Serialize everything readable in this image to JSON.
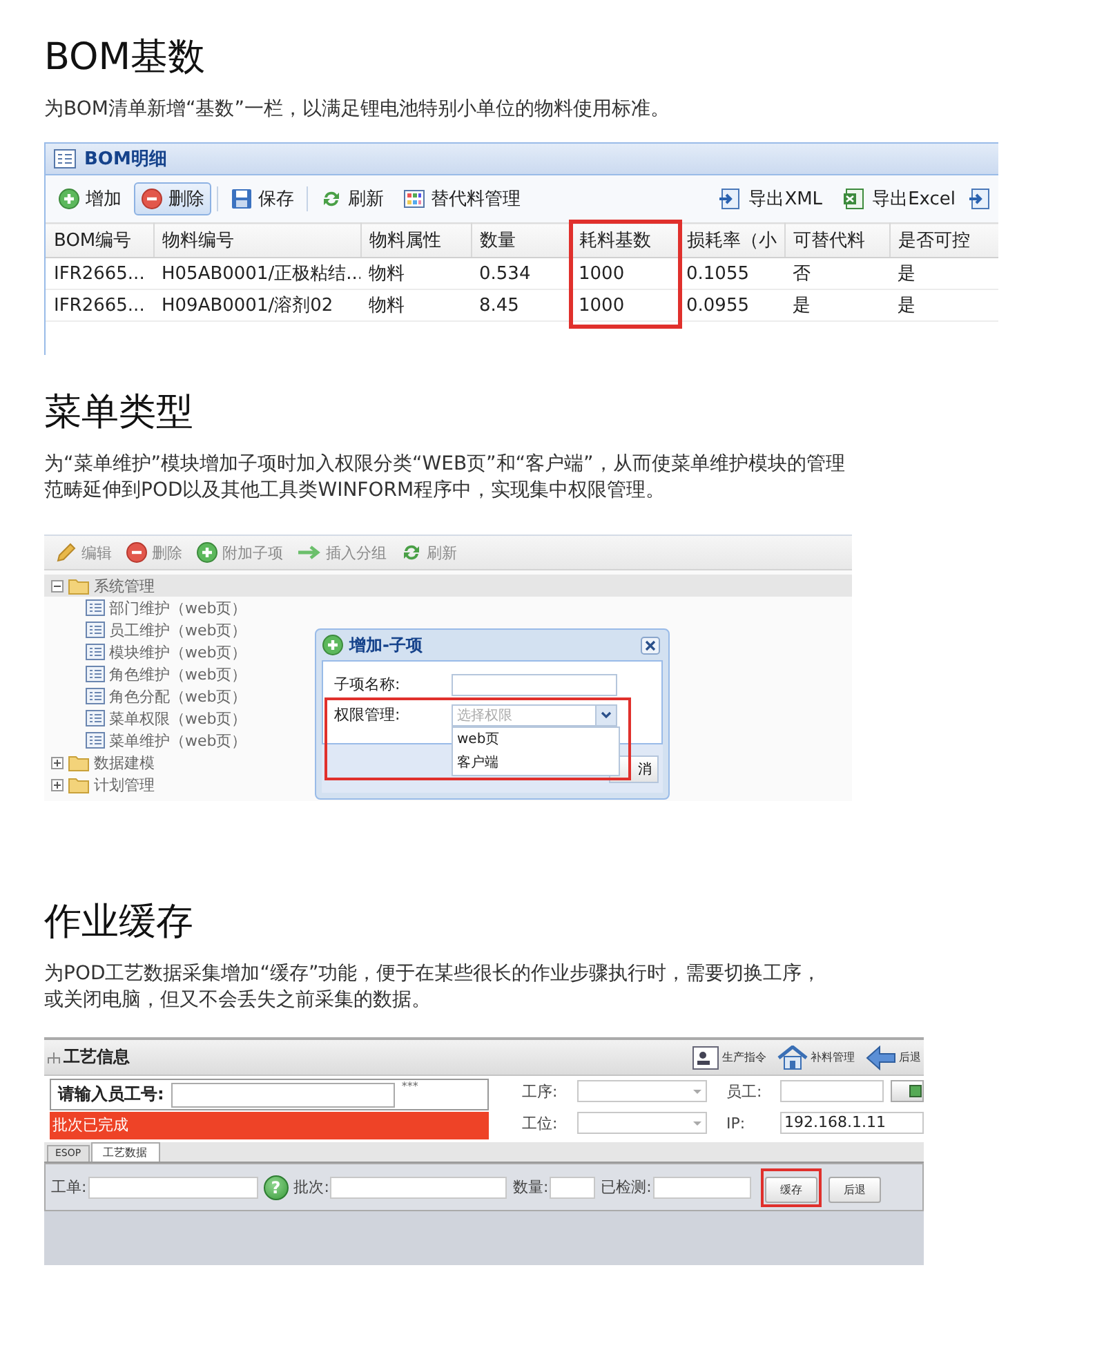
{
  "sections": [
    {
      "kind": "bom",
      "title": "BOM基数",
      "description": [
        "为BOM清单新增“基数”一栏，以满足锂电池特别小单位的物料使用标准。"
      ],
      "panel": {
        "title": "BOM明细",
        "toolbar": [
          {
            "label": "增加",
            "pressed": false
          },
          {
            "label": "删除",
            "pressed": true
          },
          {
            "label": "保存",
            "pressed": false
          },
          {
            "label": "刷新",
            "pressed": false
          },
          {
            "label": "替代料管理",
            "pressed": false
          }
        ],
        "toolbar_right": [
          {
            "label": "导出XML"
          },
          {
            "label": "导出Excel"
          }
        ],
        "columns": [
          {
            "label": "BOM编号",
            "highlighted": false
          },
          {
            "label": "物料编号",
            "highlighted": false
          },
          {
            "label": "物料属性",
            "highlighted": false
          },
          {
            "label": "数量",
            "highlighted": false
          },
          {
            "label": "耗料基数",
            "highlighted": true
          },
          {
            "label": "损耗率（小",
            "highlighted": false
          },
          {
            "label": "可替代料",
            "highlighted": false
          },
          {
            "label": "是否可控",
            "highlighted": false
          }
        ],
        "rows": [
          [
            "IFR2665...",
            "H05AB0001/正极粘结...",
            "物料",
            "0.534",
            "1000",
            "0.1055",
            "否",
            "是"
          ],
          [
            "IFR2665...",
            "H09AB0001/溶剂02",
            "物料",
            "8.45",
            "1000",
            "0.0955",
            "是",
            "是"
          ]
        ]
      }
    },
    {
      "kind": "menu",
      "title": "菜单类型",
      "description": [
        "为“菜单维护”模块增加子项时加入权限分类“WEB页”和“客户端”，从而使菜单维护模块的管理",
        "范畴延伸到POD以及其他工具类WINFORM程序中，实现集中权限管理。"
      ],
      "panel": {
        "toolbar": [
          {
            "label": "编辑"
          },
          {
            "label": "删除"
          },
          {
            "label": "附加子项"
          },
          {
            "label": "插入分组"
          },
          {
            "label": "刷新"
          }
        ],
        "tree": [
          {
            "label": "系统管理",
            "expanded": true,
            "selected": true,
            "children": [
              {
                "label": "部门维护（web页）",
                "selected": false
              },
              {
                "label": "员工维护（web页）",
                "selected": false
              },
              {
                "label": "模块维护（web页）",
                "selected": false
              },
              {
                "label": "角色维护（web页）",
                "selected": false
              },
              {
                "label": "角色分配（web页）",
                "selected": false
              },
              {
                "label": "菜单权限（web页）",
                "selected": false
              },
              {
                "label": "菜单维护（web页）",
                "selected": false
              }
            ]
          },
          {
            "label": "数据建模",
            "expanded": false,
            "selected": false
          },
          {
            "label": "计划管理",
            "expanded": false,
            "selected": false
          }
        ],
        "dialog": {
          "title": "增加-子项",
          "fields": [
            {
              "label": "子项名称:",
              "kind": "text",
              "highlighted": false
            },
            {
              "label": "权限管理:",
              "kind": "select",
              "placeholder": "选择权限",
              "options": [
                "web页",
                "客户端"
              ],
              "highlighted": true
            }
          ],
          "buttons": [
            "消"
          ]
        }
      }
    },
    {
      "kind": "process",
      "title": "作业缓存",
      "description": [
        "为POD工艺数据采集增加“缓存”功能，便于在某些很长的作业步骤执行时，需要切换工序，",
        "或关闭电脑，但又不会丢失之前采集的数据。"
      ],
      "panel": {
        "title": "工艺信息",
        "actions": [
          {
            "label": "生产指令"
          },
          {
            "label": "补料管理"
          },
          {
            "label": "后退"
          }
        ],
        "login": {
          "label": "请输入员工号:",
          "mask": "***"
        },
        "alert": "批次已完成",
        "fields": [
          {
            "label": "工序:",
            "kind": "select"
          },
          {
            "label": "员工:",
            "kind": "text-button"
          },
          {
            "label": "工位:",
            "kind": "select"
          },
          {
            "label": "IP:",
            "kind": "text",
            "value": "192.168.1.11"
          }
        ],
        "tabs": [
          {
            "label": "ESOP",
            "selected": false
          },
          {
            "label": "工艺数据",
            "selected": true
          }
        ],
        "form": [
          {
            "label": "工单:",
            "help": "?"
          },
          {
            "label": "批次:"
          },
          {
            "label": "数量:"
          },
          {
            "label": "已检测:"
          }
        ],
        "buttons": [
          {
            "label": "缓存",
            "highlighted": true
          },
          {
            "label": "后退",
            "highlighted": false
          }
        ]
      }
    }
  ]
}
